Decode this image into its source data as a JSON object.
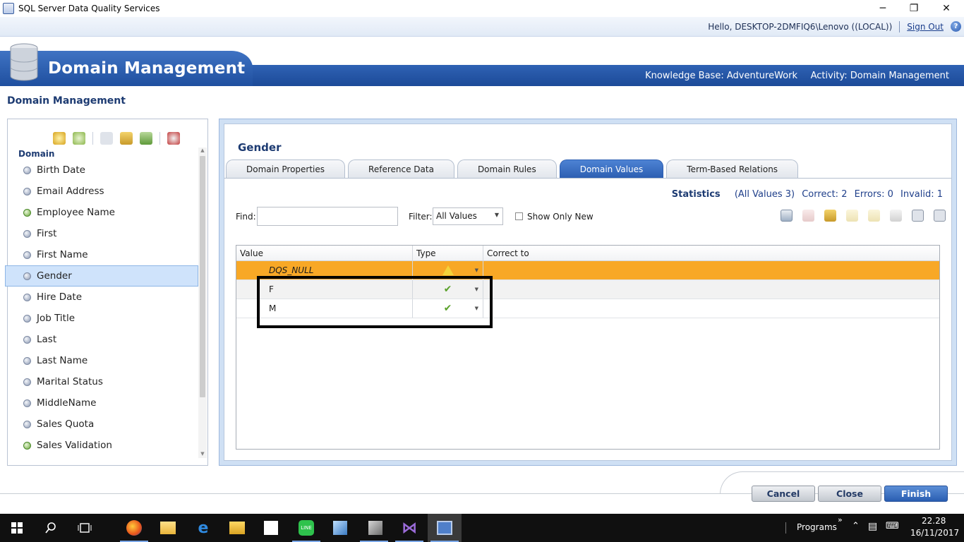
{
  "window": {
    "title": "SQL Server Data Quality Services",
    "minimize": "─",
    "restore": "❐",
    "close": "✕"
  },
  "userbar": {
    "hello": "Hello, DESKTOP-2DMFIQ6\\Lenovo ((LOCAL))",
    "signout": "Sign Out",
    "help": "?"
  },
  "header": {
    "heading": "Domain Management",
    "knowledge_base": "Knowledge Base: AdventureWork",
    "activity": "Activity: Domain Management"
  },
  "page_title": "Domain Management",
  "domain_panel": {
    "label": "Domain",
    "items": [
      {
        "label": "Birth Date",
        "kind": "single"
      },
      {
        "label": "Email Address",
        "kind": "single"
      },
      {
        "label": "Employee Name",
        "kind": "composite"
      },
      {
        "label": "First",
        "kind": "single"
      },
      {
        "label": "First Name",
        "kind": "single"
      },
      {
        "label": "Gender",
        "kind": "single",
        "selected": true
      },
      {
        "label": "Hire Date",
        "kind": "single"
      },
      {
        "label": "Job Title",
        "kind": "single"
      },
      {
        "label": "Last",
        "kind": "single"
      },
      {
        "label": "Last Name",
        "kind": "single"
      },
      {
        "label": "Marital Status",
        "kind": "single"
      },
      {
        "label": "MiddleName",
        "kind": "single"
      },
      {
        "label": "Sales Quota",
        "kind": "single"
      },
      {
        "label": "Sales Validation",
        "kind": "composite"
      }
    ]
  },
  "detail": {
    "domain_name": "Gender",
    "tabs": [
      "Domain Properties",
      "Reference Data",
      "Domain Rules",
      "Domain Values",
      "Term-Based Relations"
    ],
    "active_tab": "Domain Values",
    "statistics": {
      "label": "Statistics",
      "all_values": "(All Values 3)",
      "correct": "Correct: 2",
      "errors": "Errors: 0",
      "invalid": "Invalid: 1"
    },
    "find_label": "Find:",
    "find_value": "",
    "filter_label": "Filter:",
    "filter_value": "All Values",
    "show_only_new_label": "Show Only New",
    "grid": {
      "columns": [
        "Value",
        "Type",
        "Correct to"
      ],
      "rows": [
        {
          "value": "DQS_NULL",
          "type": "warning-icon",
          "correct_to": "",
          "status": "invalid"
        },
        {
          "value": "F",
          "type": "check-icon",
          "correct_to": "",
          "status": "correct"
        },
        {
          "value": "M",
          "type": "check-icon",
          "correct_to": "",
          "status": "correct"
        }
      ]
    }
  },
  "buttons": {
    "cancel": "Cancel",
    "close": "Close",
    "finish": "Finish"
  },
  "taskbar": {
    "programs": "Programs",
    "time": "22.28",
    "date": "16/11/2017"
  }
}
